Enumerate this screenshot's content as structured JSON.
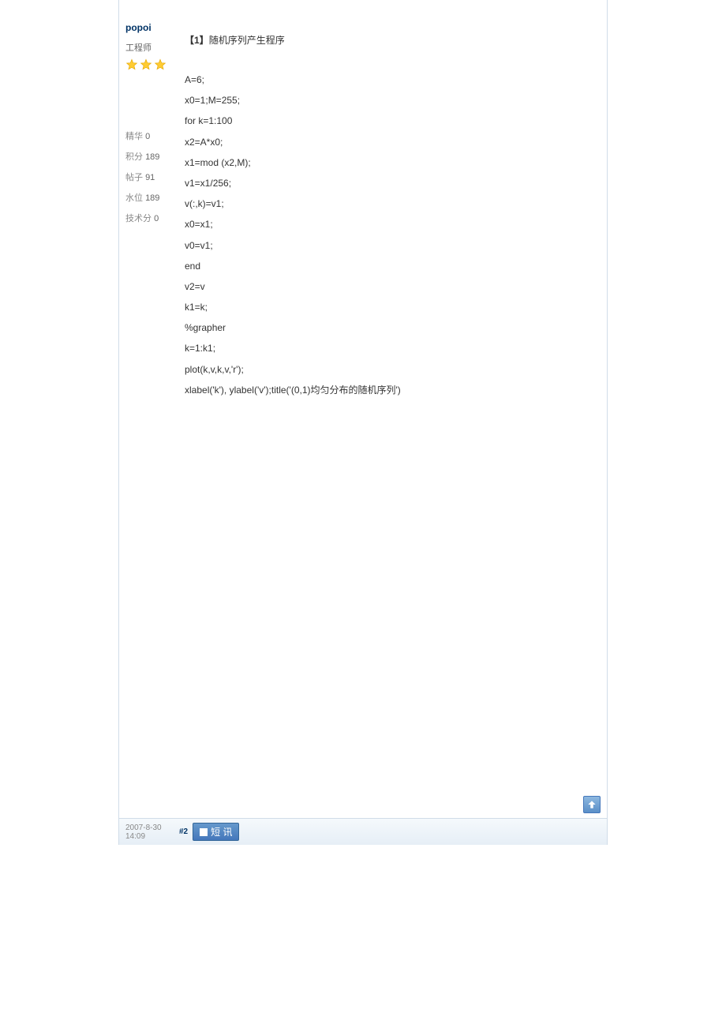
{
  "user": {
    "name": "popoi",
    "title": "工程师",
    "stars": 3,
    "stats": [
      {
        "label": "精华",
        "value": "0"
      },
      {
        "label": "积分",
        "value": "189"
      },
      {
        "label": "帖子",
        "value": "91"
      },
      {
        "label": "水位",
        "value": "189"
      },
      {
        "label": "技术分",
        "value": "0"
      }
    ]
  },
  "post": {
    "title_prefix": "【1】",
    "title_text": "随机序列产生程序",
    "code_lines": [
      "A=6;",
      "x0=1;M=255;",
      "for k=1:100",
      "x2=A*x0;",
      "x1=mod (x2,M);",
      "v1=x1/256;",
      "v(:,k)=v1;",
      "x0=x1;",
      "v0=v1;",
      "end",
      "v2=v",
      "k1=k;",
      "%grapher",
      "k=1:k1;",
      "plot(k,v,k,v,'r');",
      "xlabel('k'), ylabel('v');title('(0,1)均匀分布的随机序列')"
    ]
  },
  "footer": {
    "timestamp": "2007-8-30 14:09",
    "post_number": "#2",
    "pm_label": "短 讯"
  }
}
